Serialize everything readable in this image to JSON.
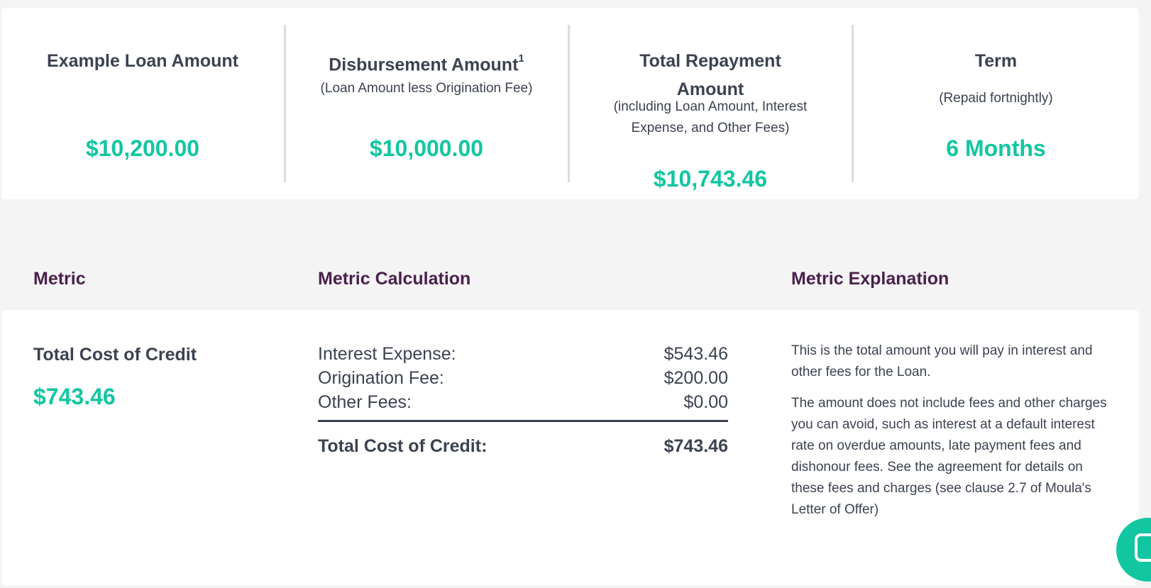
{
  "summary": {
    "loan": {
      "title": "Example Loan Amount",
      "value": "$10,200.00"
    },
    "disbursement": {
      "title": "Disbursement Amount",
      "sup": "1",
      "subtitle": "(Loan Amount less Origination Fee)",
      "value": "$10,000.00"
    },
    "repayment": {
      "title": "Total Repayment Amount",
      "subtitle": "(including Loan Amount, Interest Expense, and Other Fees)",
      "value": "$10,743.46"
    },
    "term": {
      "title": "Term",
      "subtitle": "(Repaid fortnightly)",
      "value": "6 Months"
    }
  },
  "table_headers": {
    "metric": "Metric",
    "calculation": "Metric Calculation",
    "explanation": "Metric Explanation"
  },
  "metric": {
    "name": "Total Cost of Credit",
    "value": "$743.46",
    "calculation": [
      {
        "label": "Interest Expense:",
        "amount": "$543.46"
      },
      {
        "label": "Origination Fee:",
        "amount": "$200.00"
      },
      {
        "label": "Other Fees:",
        "amount": "$0.00"
      }
    ],
    "total": {
      "label": "Total Cost of Credit:",
      "amount": "$743.46"
    },
    "explanation": [
      "This is the total amount you will pay in interest and other fees for the Loan.",
      "The amount does not include fees and other charges you can avoid, such as interest at a default interest rate on overdue amounts, late payment fees and dishonour fees. See the agreement for details on these fees and charges (see clause 2.7 of Moula's Letter of Offer)"
    ]
  },
  "chat": {
    "icon": "chat-icon"
  },
  "colors": {
    "accent": "#12c6a1",
    "header": "#4a1f4c",
    "text": "#3b4250",
    "background": "#f4f4f4"
  }
}
